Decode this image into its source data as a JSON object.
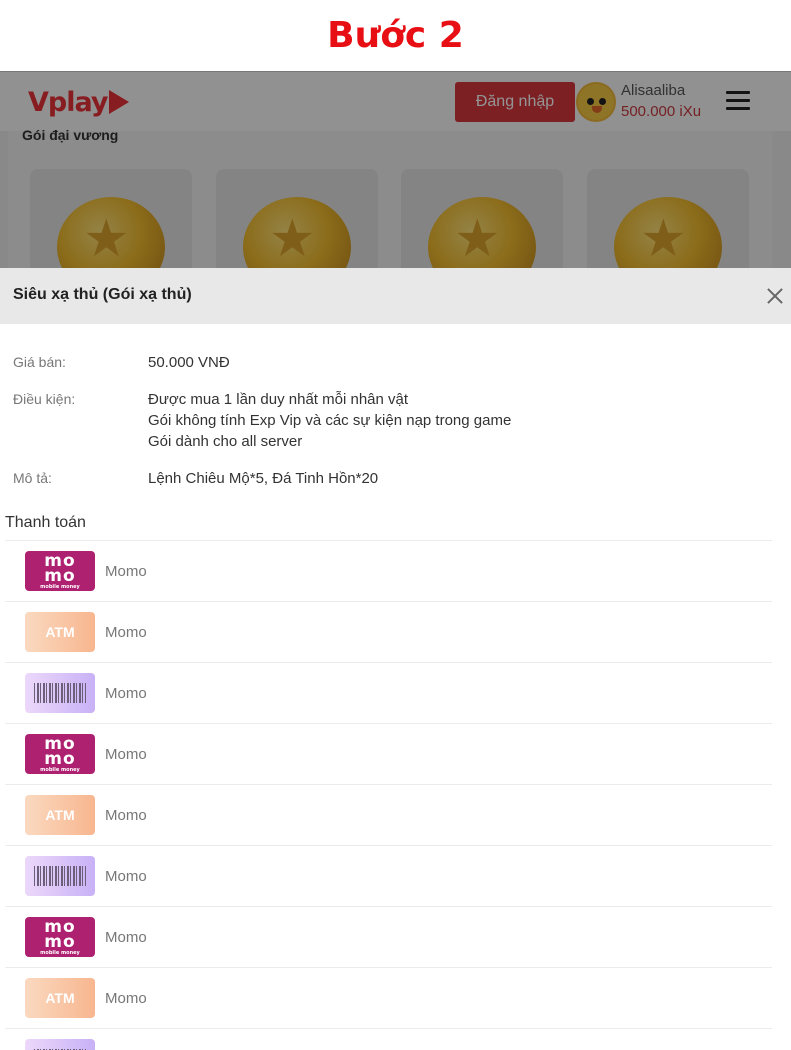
{
  "step_title": "Bước 2",
  "header": {
    "logo_text": "Vplay",
    "login_label": "Đăng nhập",
    "username": "Alisaaliba",
    "balance": "500.000 iXu"
  },
  "background": {
    "section_title": "Gói đại vương",
    "package_icon": "gold-coin-icon"
  },
  "modal": {
    "title": "Siêu xạ thủ (Gói xạ thủ)",
    "price_label": "Giá bán:",
    "price_value": "50.000 VNĐ",
    "condition_label": "Điều kiện:",
    "conditions": [
      "Được mua 1 lần duy nhất mỗi nhân vật",
      "Gói không tính Exp Vip và các sự kiện nạp trong game",
      "Gói dành cho all server"
    ],
    "description_label": "Mô tả:",
    "description_value": "Lệnh Chiêu Mộ*5, Đá Tinh Hồn*20",
    "payment_title": "Thanh toán",
    "payment_methods": [
      {
        "logo": "momo",
        "logo_text_1": "mo",
        "logo_text_2": "mo",
        "logo_sub": "mobile money",
        "label": "Momo"
      },
      {
        "logo": "atm",
        "logo_text_1": "ATM",
        "label": "Momo"
      },
      {
        "logo": "card",
        "label": "Momo"
      },
      {
        "logo": "momo",
        "logo_text_1": "mo",
        "logo_text_2": "mo",
        "logo_sub": "mobile money",
        "label": "Momo"
      },
      {
        "logo": "atm",
        "logo_text_1": "ATM",
        "label": "Momo"
      },
      {
        "logo": "card",
        "label": "Momo"
      },
      {
        "logo": "momo",
        "logo_text_1": "mo",
        "logo_text_2": "mo",
        "logo_sub": "mobile money",
        "label": "Momo"
      },
      {
        "logo": "atm",
        "logo_text_1": "ATM",
        "label": "Momo"
      },
      {
        "logo": "card",
        "label": ""
      }
    ]
  },
  "colors": {
    "step_title": "#e80f14",
    "brand_red": "#d7373f",
    "momo": "#ae2070"
  }
}
